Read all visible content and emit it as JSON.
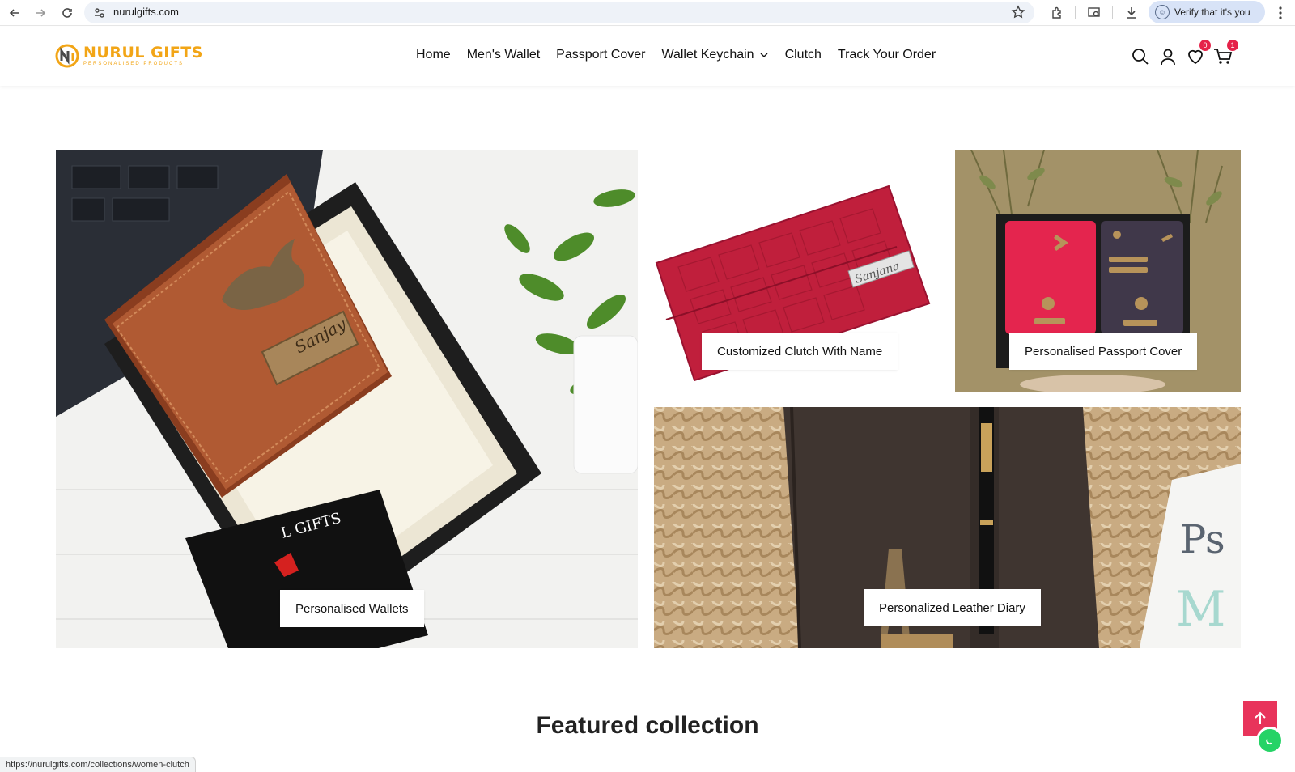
{
  "browser": {
    "url": "nurulgifts.com",
    "verify_label": "Verify that it's you",
    "status_url": "https://nurulgifts.com/collections/women-clutch"
  },
  "header": {
    "logo_main": "NURUL GIFTS",
    "logo_sub": "PERSONALISED PRODUCTS",
    "nav": [
      {
        "label": "Home"
      },
      {
        "label": "Men's Wallet"
      },
      {
        "label": "Passport Cover"
      },
      {
        "label": "Wallet Keychain"
      },
      {
        "label": "Clutch"
      },
      {
        "label": "Track Your Order"
      }
    ],
    "wishlist_count": "0",
    "cart_count": "1"
  },
  "collage": {
    "wallets_label": "Personalised Wallets",
    "clutch_label": "Customized Clutch With Name",
    "passport_label": "Personalised Passport Cover",
    "diary_label": "Personalized Leather Diary",
    "wallet_name": "Sanjay",
    "clutch_name": "Sanjana"
  },
  "featured": {
    "title": "Featured collection"
  },
  "colors": {
    "brand": "#f2a516",
    "accent": "#e8345b",
    "badge": "#e52249"
  }
}
